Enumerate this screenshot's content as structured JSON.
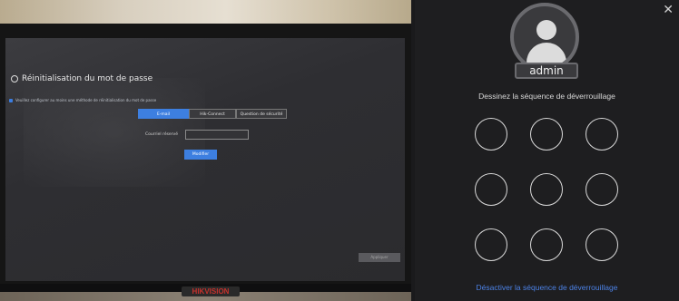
{
  "monitor": {
    "brand": "HIKVISION",
    "screen": {
      "title": "Réinitialisation du mot de passe",
      "note": "Veuillez configurer au moins une méthode de réinitialisation du mot de passe",
      "tabs": [
        "E-mail",
        "Hik-Connect",
        "Question de sécurité"
      ],
      "email_label": "Courriel réservé",
      "email_value": "",
      "edit_button": "Modifier",
      "bottom_button": "Appliquer"
    }
  },
  "unlock": {
    "close_icon": "close-icon",
    "avatar_icon": "user-avatar-icon",
    "username": "admin",
    "prompt": "Dessinez la séquence de déverrouillage",
    "pattern_dots": 9,
    "disable_link": "Désactiver la séquence de déverrouillage"
  }
}
